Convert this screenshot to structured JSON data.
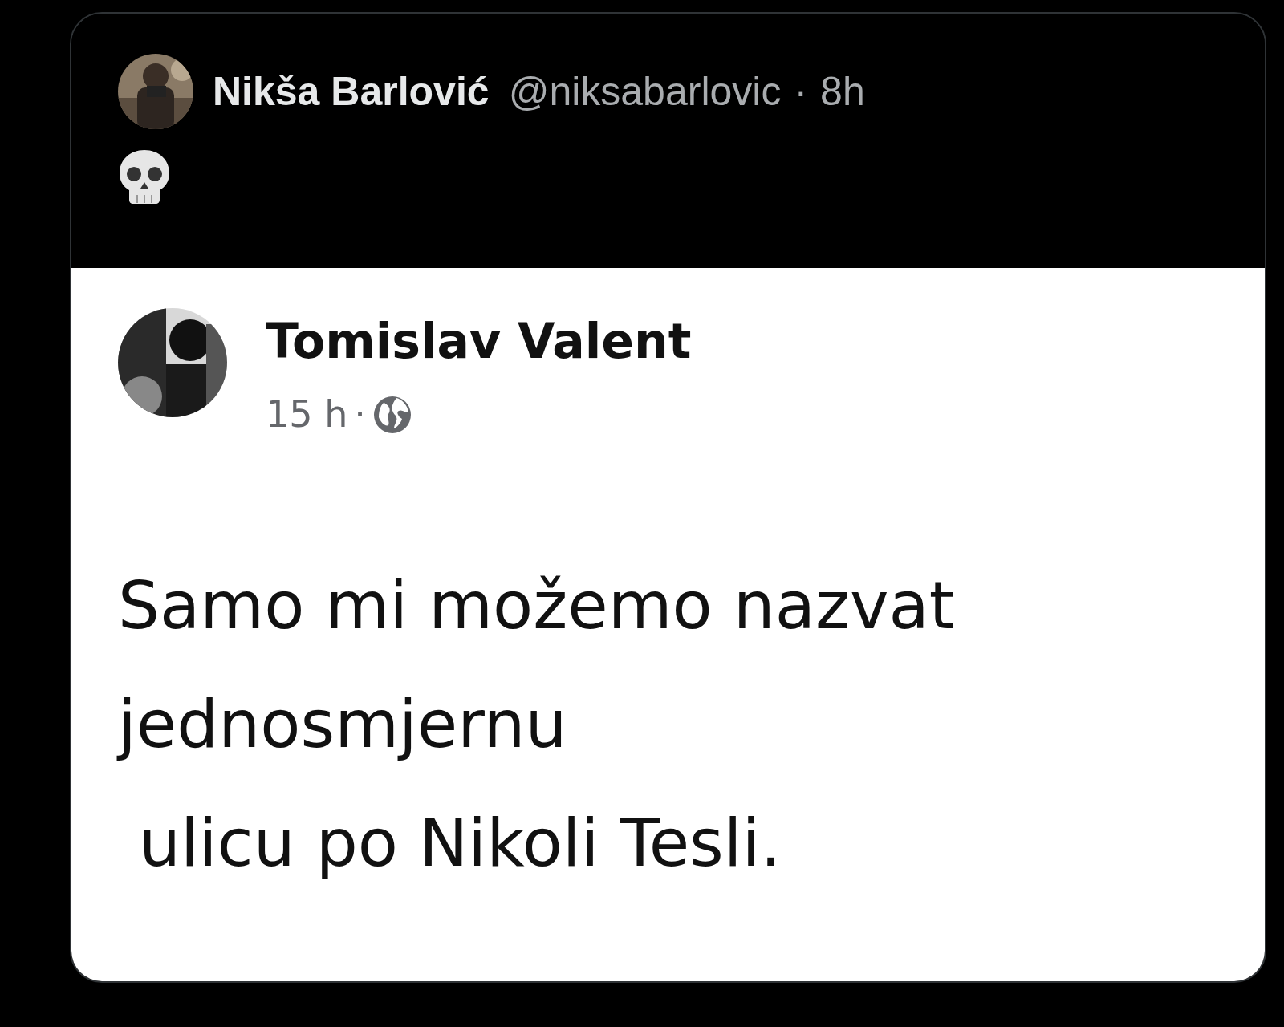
{
  "tweet": {
    "author_name": "Nikša Barlović",
    "handle": "@niksabarlovic",
    "separator": "·",
    "time": "8h"
  },
  "embedded_post": {
    "author_name": "Tomislav Valent",
    "time": "15 h",
    "separator": "·",
    "lines": [
      "Samo mi možemo nazvat",
      "jednosmjernu",
      " ulicu po Nikoli Tesli."
    ]
  }
}
